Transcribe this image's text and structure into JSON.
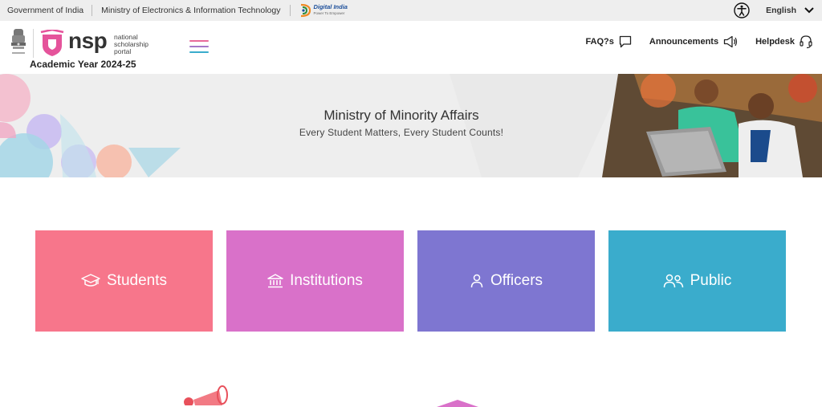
{
  "topbar": {
    "gov": "Government of India",
    "ministry": "Ministry of Electronics & Information Technology",
    "digital_india": "Digital India",
    "digital_india_tag": "Power To Empower",
    "language": "English"
  },
  "header": {
    "logo_main": "nsp",
    "logo_line1": "national",
    "logo_line2": "scholarship",
    "logo_line3": "portal",
    "academic_year": "Academic Year 2024-25",
    "nav": {
      "faq": "FAQ?s",
      "announcements": "Announcements",
      "helpdesk": "Helpdesk"
    }
  },
  "banner": {
    "title": "Ministry of Minority Affairs",
    "subtitle": "Every Student Matters, Every Student Counts!"
  },
  "tiles": [
    {
      "label": "Students",
      "icon": "graduation-cap-icon",
      "color": "#f7768b"
    },
    {
      "label": "Institutions",
      "icon": "institution-icon",
      "color": "#d971c9"
    },
    {
      "label": "Officers",
      "icon": "person-icon",
      "color": "#7e76d1"
    },
    {
      "label": "Public",
      "icon": "people-icon",
      "color": "#3aaccc"
    }
  ]
}
